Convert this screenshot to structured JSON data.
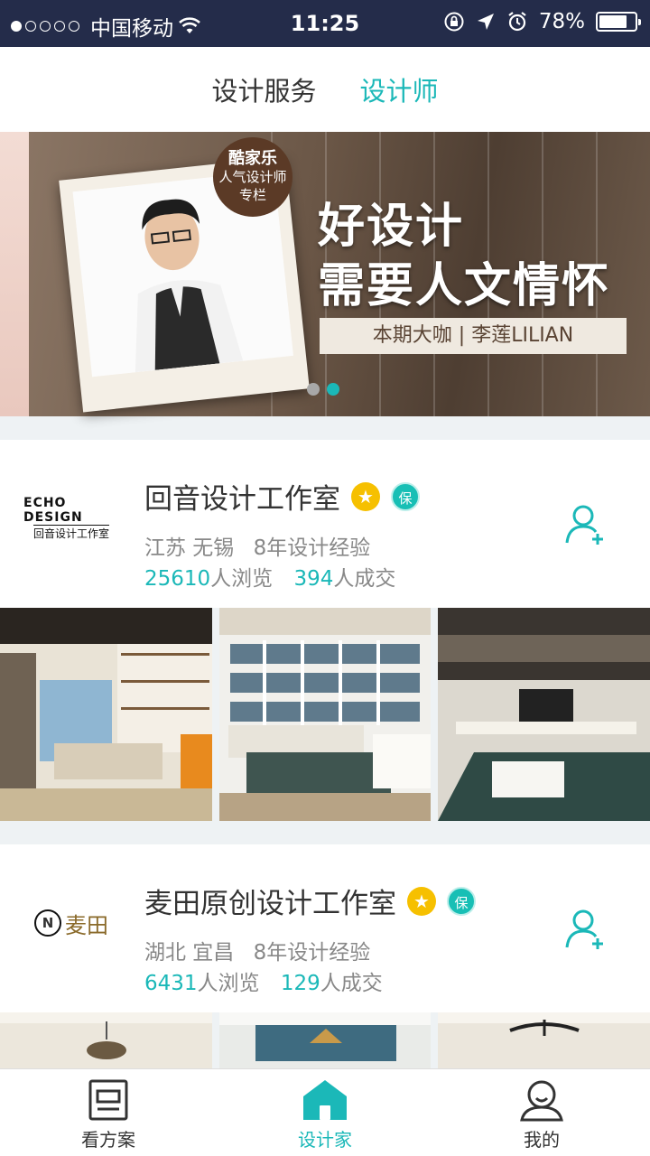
{
  "status_bar": {
    "carrier": "中国移动",
    "time": "11:25",
    "battery": "78%",
    "battery_level": 0.78,
    "icons": [
      "signal-dots-icon",
      "wifi-icon",
      "rotation-lock-icon",
      "location-icon",
      "alarm-icon",
      "battery-icon"
    ]
  },
  "top_tabs": {
    "items": [
      {
        "label": "设计服务",
        "active": false
      },
      {
        "label": "设计师",
        "active": true
      }
    ]
  },
  "banner": {
    "badge_line1": "酷家乐",
    "badge_line2": "人气设计师",
    "badge_line3": "专栏",
    "headline_line1": "好设计",
    "headline_line2": "需要人文情怀",
    "caption": "本期大咖 | 李莲LILIAN",
    "page_count": 2,
    "active_page": 2
  },
  "designers": [
    {
      "logo_text": "ECHO DESIGN",
      "logo_subtext": "回音设计工作室",
      "name": "回音设计工作室",
      "star_icon": "★",
      "bao_label": "保",
      "location": "江苏 无锡",
      "experience": "8年设计经验",
      "views_num": "25610",
      "views_suffix": "人浏览",
      "deals_num": "394",
      "deals_suffix": "人成交"
    },
    {
      "logo_text": "麦田",
      "logo_subtext": "",
      "name": "麦田原创设计工作室",
      "star_icon": "★",
      "bao_label": "保",
      "location": "湖北 宜昌",
      "experience": "8年设计经验",
      "views_num": "6431",
      "views_suffix": "人浏览",
      "deals_num": "129",
      "deals_suffix": "人成交"
    }
  ],
  "bottom_nav": {
    "items": [
      {
        "label": "看方案",
        "icon": "document-icon",
        "active": false
      },
      {
        "label": "设计家",
        "icon": "home-icon",
        "active": true
      },
      {
        "label": "我的",
        "icon": "user-icon",
        "active": false
      }
    ]
  },
  "colors": {
    "accent": "#1bb8b8",
    "status_bar_bg": "#242c4a",
    "star": "#f6c000",
    "bao": "#18bfb5"
  }
}
